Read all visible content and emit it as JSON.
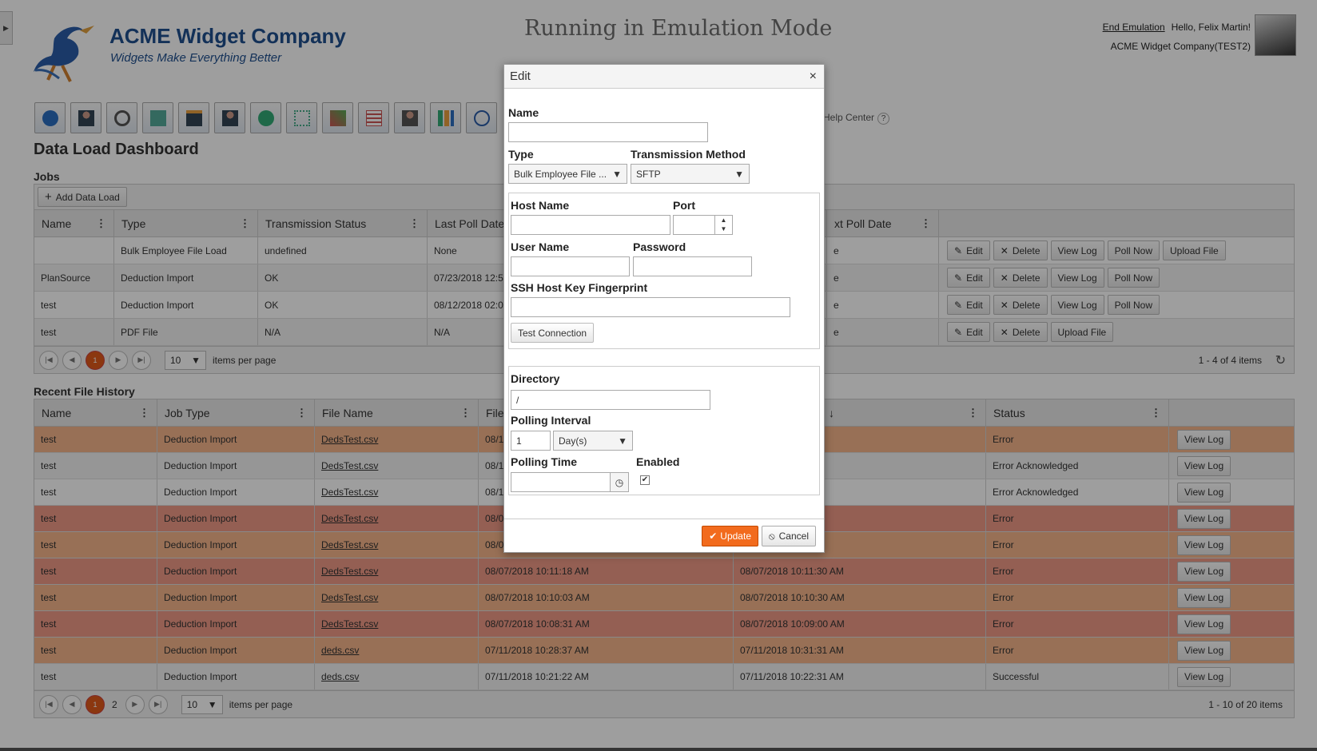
{
  "header": {
    "company": "ACME Widget Company",
    "tagline": "Widgets Make Everything Better",
    "emulation": "Running in Emulation Mode",
    "end_emulation": "End Emulation",
    "greeting": "Hello, Felix Martin!",
    "org": "ACME Widget Company(TEST2)",
    "help_center": "Help Center",
    "help_icon": "?"
  },
  "toolbar": {
    "icons": [
      "home-icon",
      "employee-icon",
      "search-user-icon",
      "mail-icon",
      "briefcase-icon",
      "people-icon",
      "chat-icon",
      "network-icon",
      "chart-tools-icon",
      "checklist-icon",
      "person-badge-icon",
      "bar-chart-icon",
      "clock-icon"
    ]
  },
  "page": {
    "title": "Data Load Dashboard",
    "jobs_title": "Jobs",
    "add_button": "Add Data Load",
    "history_title": "Recent File History"
  },
  "jobs": {
    "columns": [
      "Name",
      "Type",
      "Transmission Status",
      "Last Poll Date",
      "xt Poll Date"
    ],
    "rows": [
      {
        "name": "",
        "type": "Bulk Employee File Load",
        "status": "undefined",
        "last": "None",
        "next": "e",
        "actions": [
          "Edit",
          "Delete",
          "View Log",
          "Poll Now",
          "Upload File"
        ]
      },
      {
        "name": "PlanSource",
        "type": "Deduction Import",
        "status": "OK",
        "last": "07/23/2018 12:5",
        "next": "e",
        "actions": [
          "Edit",
          "Delete",
          "View Log",
          "Poll Now"
        ]
      },
      {
        "name": "test",
        "type": "Deduction Import",
        "status": "OK",
        "last": "08/12/2018 02:0",
        "next": "e",
        "actions": [
          "Edit",
          "Delete",
          "View Log",
          "Poll Now"
        ]
      },
      {
        "name": "test",
        "type": "PDF File",
        "status": "N/A",
        "last": "N/A",
        "next": "e",
        "actions": [
          "Edit",
          "Delete",
          "Upload File"
        ]
      }
    ],
    "pager": {
      "page": "1",
      "page_size": "10",
      "items_per_page": "items per page",
      "info": "1 - 4 of 4 items"
    }
  },
  "history": {
    "columns": [
      "Name",
      "Job Type",
      "File Name",
      "File",
      "↓",
      "Status"
    ],
    "rows": [
      {
        "name": "test",
        "job": "Deduction Import",
        "file": "DedsTest.csv",
        "d1": "08/1",
        "d2": "3 PM",
        "status": "Error",
        "tone": "orange"
      },
      {
        "name": "test",
        "job": "Deduction Import",
        "file": "DedsTest.csv",
        "d1": "08/1",
        "d2": "",
        "status": "Error Acknowledged",
        "tone": "gray"
      },
      {
        "name": "test",
        "job": "Deduction Import",
        "file": "DedsTest.csv",
        "d1": "08/1",
        "d2": "",
        "status": "Error Acknowledged",
        "tone": "white"
      },
      {
        "name": "test",
        "job": "Deduction Import",
        "file": "DedsTest.csv",
        "d1": "08/0",
        "d2": "3 AM",
        "status": "Error",
        "tone": "red"
      },
      {
        "name": "test",
        "job": "Deduction Import",
        "file": "DedsTest.csv",
        "d1": "08/0",
        "d2": "3 AM",
        "status": "Error",
        "tone": "orange"
      },
      {
        "name": "test",
        "job": "Deduction Import",
        "file": "DedsTest.csv",
        "d1": "08/07/2018 10:11:18 AM",
        "d2": "08/07/2018 10:11:30 AM",
        "status": "Error",
        "tone": "red"
      },
      {
        "name": "test",
        "job": "Deduction Import",
        "file": "DedsTest.csv",
        "d1": "08/07/2018 10:10:03 AM",
        "d2": "08/07/2018 10:10:30 AM",
        "status": "Error",
        "tone": "orange"
      },
      {
        "name": "test",
        "job": "Deduction Import",
        "file": "DedsTest.csv",
        "d1": "08/07/2018 10:08:31 AM",
        "d2": "08/07/2018 10:09:00 AM",
        "status": "Error",
        "tone": "red"
      },
      {
        "name": "test",
        "job": "Deduction Import",
        "file": "deds.csv",
        "d1": "07/11/2018 10:28:37 AM",
        "d2": "07/11/2018 10:31:31 AM",
        "status": "Error",
        "tone": "orange"
      },
      {
        "name": "test",
        "job": "Deduction Import",
        "file": "deds.csv",
        "d1": "07/11/2018 10:21:22 AM",
        "d2": "07/11/2018 10:22:31 AM",
        "status": "Successful",
        "tone": "gray"
      }
    ],
    "action": "View Log",
    "pager": {
      "page": "1",
      "page2": "2",
      "page_size": "10",
      "items_per_page": "items per page",
      "info": "1 - 10 of 20 items"
    }
  },
  "dialog": {
    "title": "Edit",
    "close": "×",
    "name_label": "Name",
    "name_value": "",
    "type_label": "Type",
    "type_value": "Bulk Employee File ...",
    "transmission_label": "Transmission Method",
    "transmission_value": "SFTP",
    "host_label": "Host Name",
    "port_label": "Port",
    "user_label": "User Name",
    "password_label": "Password",
    "ssh_label": "SSH Host Key Fingerprint",
    "test_button": "Test Connection",
    "directory_label": "Directory",
    "directory_value": "/",
    "interval_label": "Polling Interval",
    "interval_value": "1",
    "interval_unit": "Day(s)",
    "time_label": "Polling Time",
    "enabled_label": "Enabled",
    "enabled_mark": "✔",
    "update": "Update",
    "cancel": "Cancel"
  },
  "colors": {
    "orange": "#f5b58c",
    "red": "#ef9a86",
    "gray": "#f2f2f2",
    "white": "#ffffff",
    "accent": "#f26b1d"
  }
}
